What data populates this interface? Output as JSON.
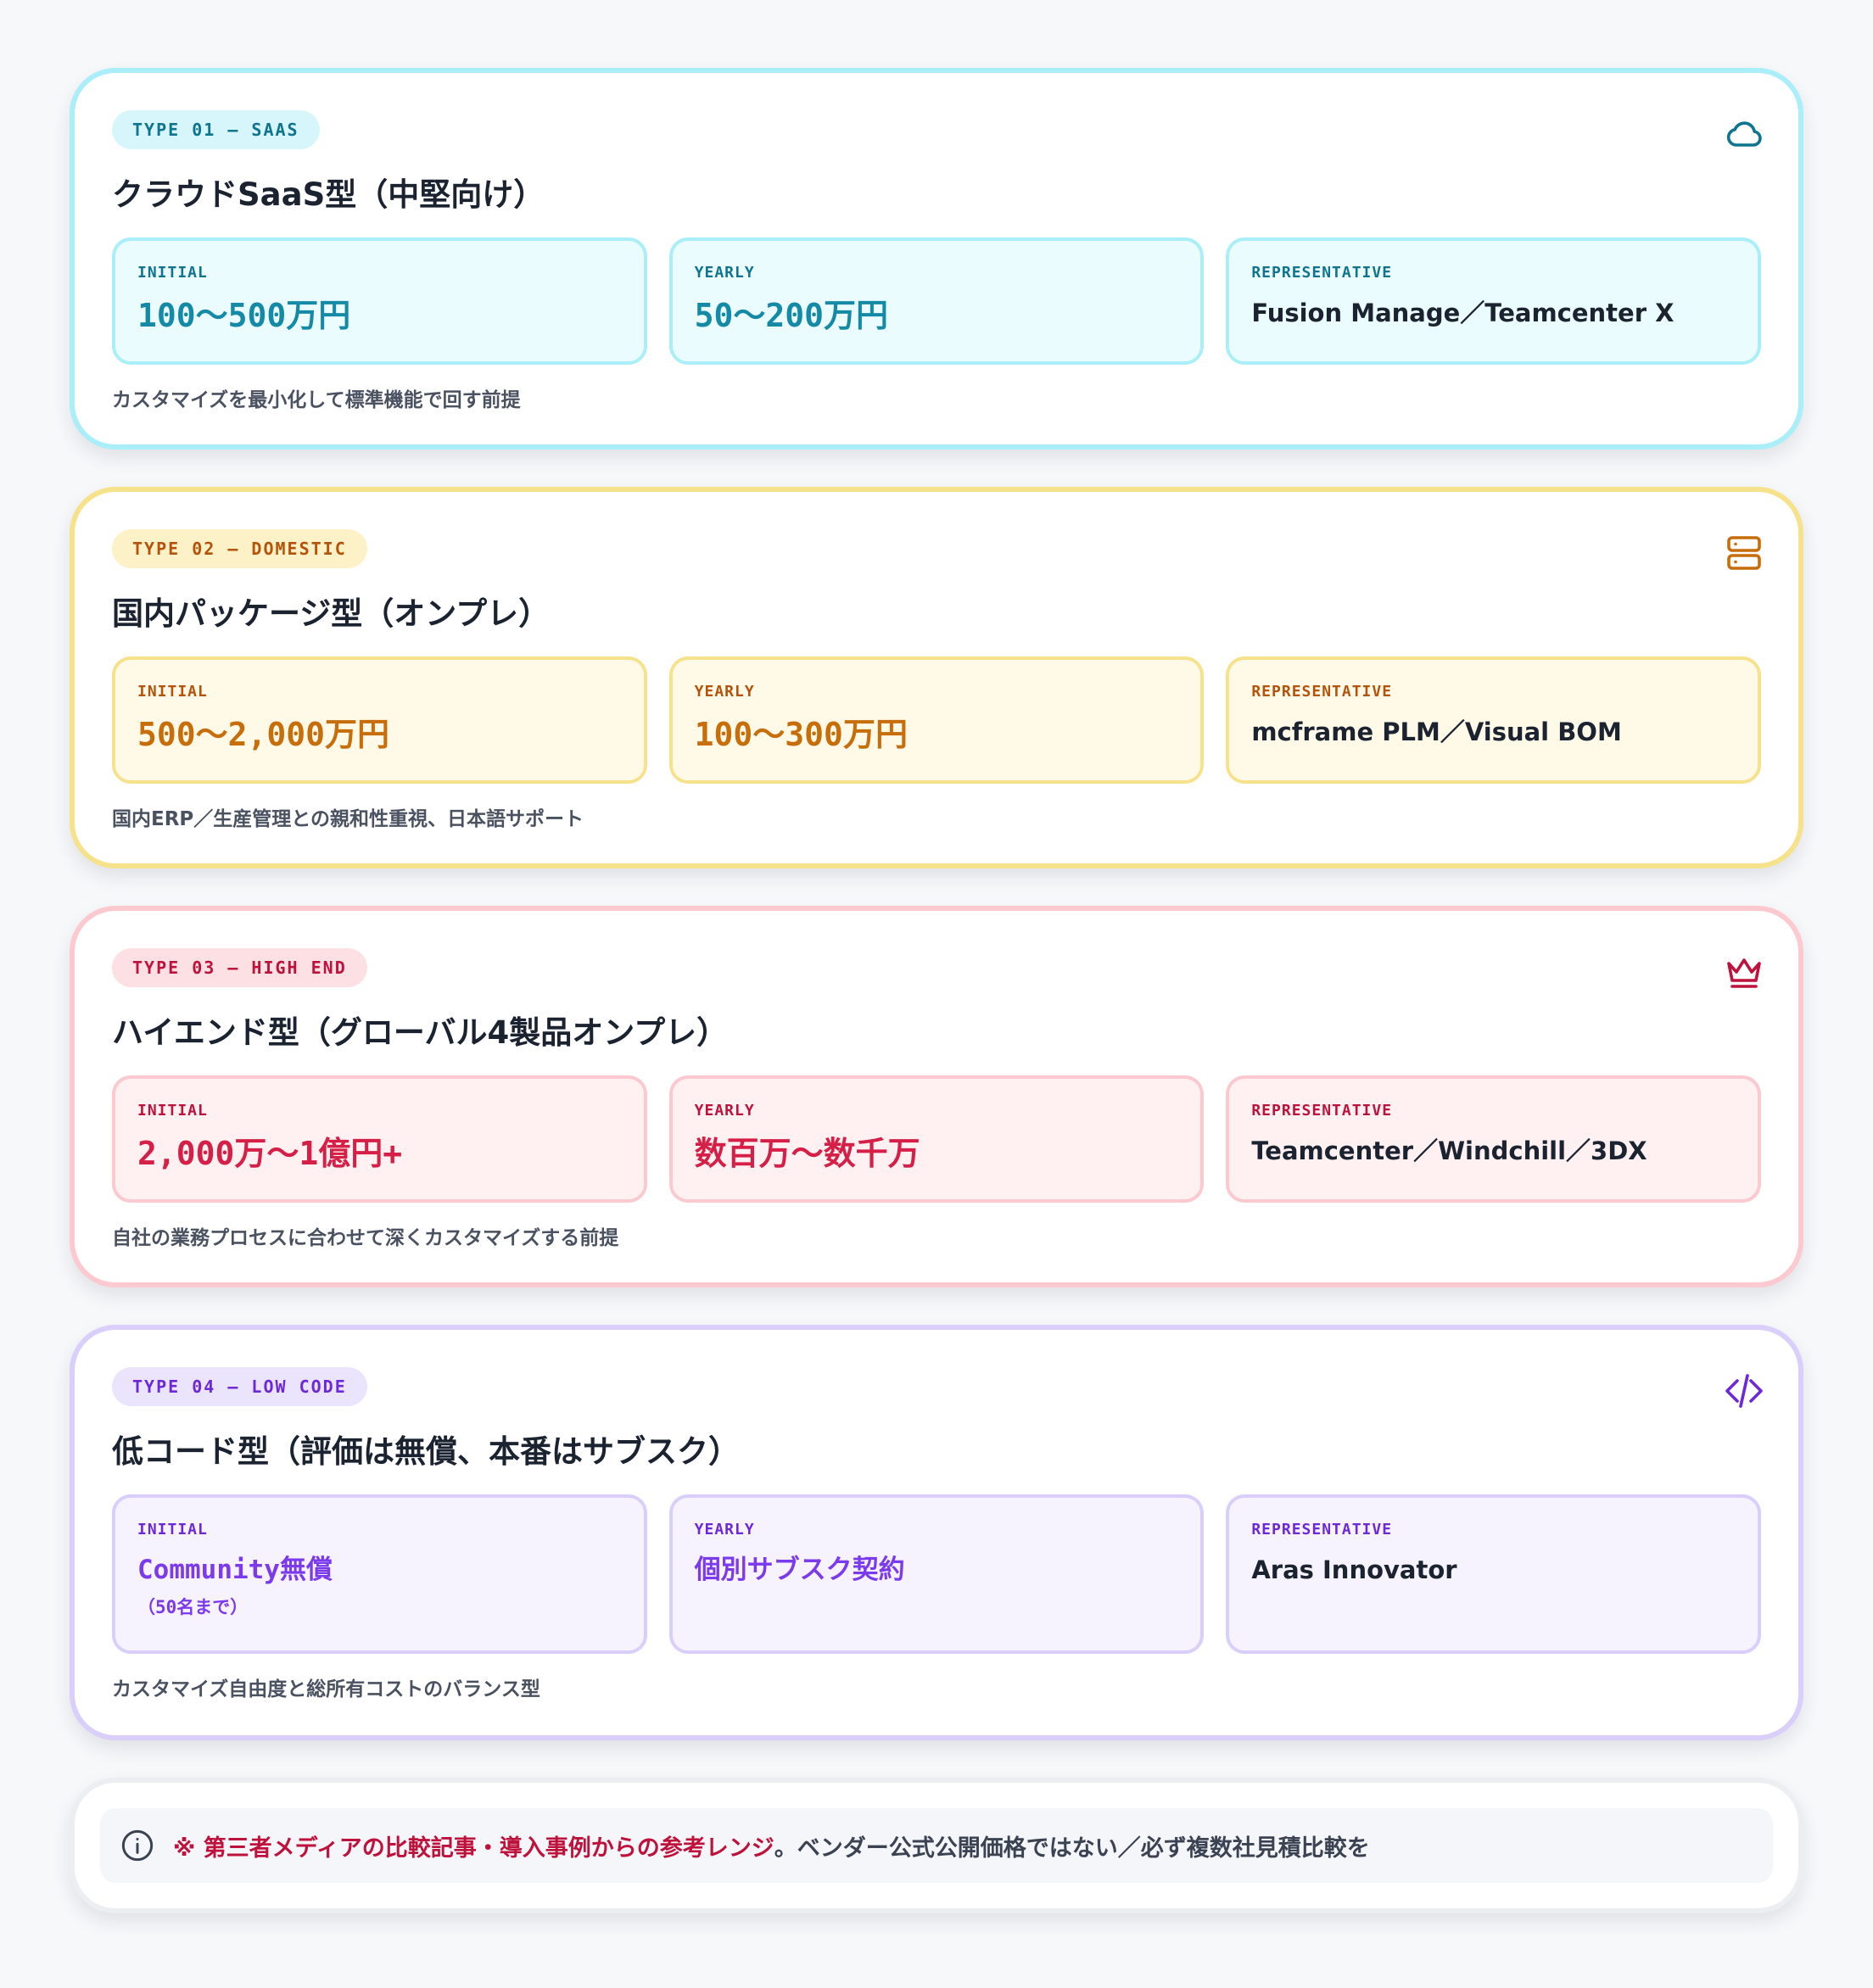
{
  "colors": {
    "saas": "#0e7490",
    "domestic": "#b45309",
    "high_end": "#be123c",
    "low_code": "#6d28d9"
  },
  "cards": [
    {
      "badge": "TYPE 01 — SAAS",
      "icon": "cloud-icon",
      "title": "クラウドSaaS型（中堅向け）",
      "initial_label": "INITIAL",
      "initial_value": "100〜500万円",
      "yearly_label": "YEARLY",
      "yearly_value": "50〜200万円",
      "rep_label": "REPRESENTATIVE",
      "rep_value": "Fusion Manage／Teamcenter X",
      "note": "カスタマイズを最小化して標準機能で回す前提"
    },
    {
      "badge": "TYPE 02 — DOMESTIC",
      "icon": "server-icon",
      "title": "国内パッケージ型（オンプレ）",
      "initial_label": "INITIAL",
      "initial_value": "500〜2,000万円",
      "yearly_label": "YEARLY",
      "yearly_value": "100〜300万円",
      "rep_label": "REPRESENTATIVE",
      "rep_value": "mcframe PLM／Visual BOM",
      "note": "国内ERP／生産管理との親和性重視、日本語サポート"
    },
    {
      "badge": "TYPE 03 — HIGH END",
      "icon": "crown-icon",
      "title": "ハイエンド型（グローバル4製品オンプレ）",
      "initial_label": "INITIAL",
      "initial_value": "2,000万〜1億円+",
      "yearly_label": "YEARLY",
      "yearly_value": "数百万〜数千万",
      "rep_label": "REPRESENTATIVE",
      "rep_value": "Teamcenter／Windchill／3DX",
      "note": "自社の業務プロセスに合わせて深くカスタマイズする前提"
    },
    {
      "badge": "TYPE 04 — LOW CODE",
      "icon": "code-icon",
      "title": "低コード型（評価は無償、本番はサブスク）",
      "initial_label": "INITIAL",
      "initial_value": "Community無償",
      "initial_sub": "（50名まで）",
      "yearly_label": "YEARLY",
      "yearly_value": "個別サブスク契約",
      "rep_label": "REPRESENTATIVE",
      "rep_value": "Aras Innovator",
      "note": "カスタマイズ自由度と総所有コストのバランス型"
    }
  ],
  "footer": {
    "icon": "info-icon",
    "highlight": "※ 第三者メディアの比較記事・導入事例からの参考レンジ",
    "rest": "。ベンダー公式公開価格ではない／必ず複数社見積比較を"
  }
}
